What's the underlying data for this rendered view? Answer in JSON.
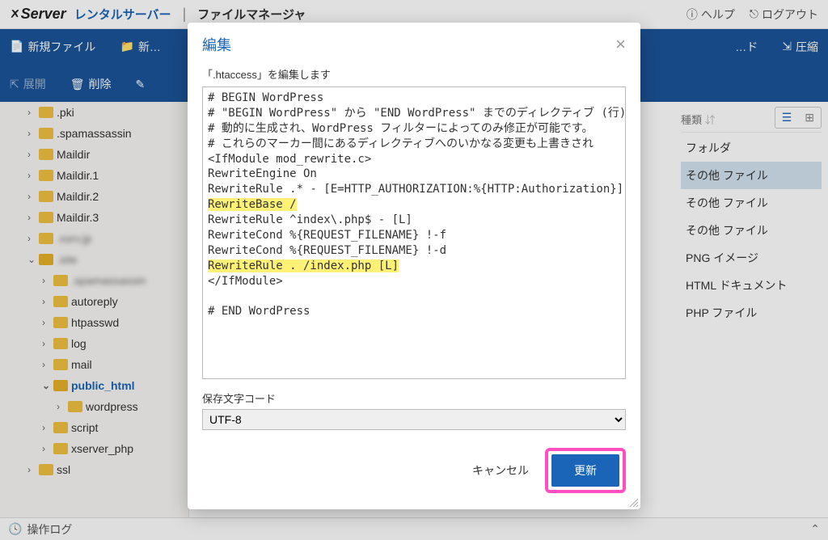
{
  "header": {
    "brand": "Server",
    "rental": "レンタルサーバー",
    "filemgr": "ファイルマネージャ",
    "help": "ヘルプ",
    "logout": "ログアウト"
  },
  "toolbar": {
    "new_file": "新規ファイル",
    "new_folder": "新…",
    "upload": "アップロード",
    "compress": "圧縮",
    "expand": "展開",
    "delete": "削除",
    "rename": "改…"
  },
  "sidebar": {
    "items": [
      {
        "label": ".pki",
        "indent": 2,
        "expand": "›"
      },
      {
        "label": ".spamassassin",
        "indent": 2,
        "expand": "›"
      },
      {
        "label": "Maildir",
        "indent": 2,
        "expand": "›"
      },
      {
        "label": "Maildir.1",
        "indent": 2,
        "expand": "›"
      },
      {
        "label": "Maildir.2",
        "indent": 2,
        "expand": "›"
      },
      {
        "label": "Maildir.3",
        "indent": 2,
        "expand": "›"
      },
      {
        "label": ".xsrv.jp",
        "indent": 2,
        "blur": true,
        "expand": "›"
      },
      {
        "label": ".site",
        "indent": 2,
        "blur": true,
        "expand": "⌄",
        "open": true
      },
      {
        "label": ".spamassassin",
        "indent": 3,
        "blur": true,
        "expand": "›"
      },
      {
        "label": "autoreply",
        "indent": 3,
        "expand": "›"
      },
      {
        "label": "htpasswd",
        "indent": 3,
        "expand": "›"
      },
      {
        "label": "log",
        "indent": 3,
        "expand": "›"
      },
      {
        "label": "mail",
        "indent": 3,
        "expand": "›"
      },
      {
        "label": "public_html",
        "indent": 3,
        "expand": "⌄",
        "selected": true,
        "open": true
      },
      {
        "label": "wordpress",
        "indent": 4,
        "expand": "›"
      },
      {
        "label": "script",
        "indent": 3,
        "expand": "›"
      },
      {
        "label": "xserver_php",
        "indent": 3,
        "expand": "›"
      },
      {
        "label": "ssl",
        "indent": 2,
        "expand": "›"
      }
    ]
  },
  "right": {
    "header": "種類",
    "items": [
      {
        "label": "フォルダ"
      },
      {
        "label": "その他 ファイル",
        "selected": true
      },
      {
        "label": "その他 ファイル"
      },
      {
        "label": "その他 ファイル"
      },
      {
        "label": "PNG イメージ"
      },
      {
        "label": "HTML ドキュメント"
      },
      {
        "label": "PHP ファイル"
      }
    ]
  },
  "bottom": {
    "oplog": "操作ログ"
  },
  "modal": {
    "title": "編集",
    "desc": "「.htaccess」を編集します",
    "lines": [
      {
        "t": "# BEGIN WordPress"
      },
      {
        "t": "# \"BEGIN WordPress\" から \"END WordPress\" までのディレクティブ (行) は"
      },
      {
        "t": "# 動的に生成され、WordPress フィルターによってのみ修正が可能です。"
      },
      {
        "t": "# これらのマーカー間にあるディレクティブへのいかなる変更も上書きされ"
      },
      {
        "t": "<IfModule mod_rewrite.c>"
      },
      {
        "t": "RewriteEngine On"
      },
      {
        "t": "RewriteRule .* - [E=HTTP_AUTHORIZATION:%{HTTP:Authorization}]"
      },
      {
        "t": "RewriteBase /",
        "hl": true
      },
      {
        "t": "RewriteRule ^index\\.php$ - [L]"
      },
      {
        "t": "RewriteCond %{REQUEST_FILENAME} !-f"
      },
      {
        "t": "RewriteCond %{REQUEST_FILENAME} !-d"
      },
      {
        "t": "RewriteRule . /index.php [L]",
        "hl": true
      },
      {
        "t": "</IfModule>"
      },
      {
        "t": ""
      },
      {
        "t": "# END WordPress"
      }
    ],
    "enc_label": "保存文字コード",
    "enc_value": "UTF-8",
    "cancel": "キャンセル",
    "submit": "更新"
  }
}
